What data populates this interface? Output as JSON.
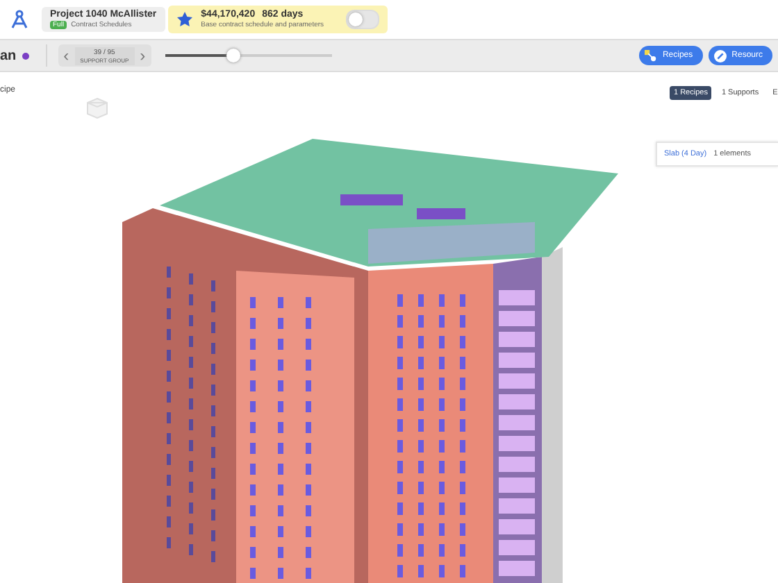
{
  "header": {
    "project": {
      "title": "Project 1040 McAllister",
      "badge": "Full",
      "subtitle": "Contract Schedules"
    },
    "contract": {
      "cost": "$44,170,420",
      "duration": "862 days",
      "description": "Base contract schedule and parameters",
      "on": false
    }
  },
  "toolbar": {
    "title": "an",
    "nav": {
      "prev": "‹",
      "position": "39 / 95",
      "group": "SUPPORT GROUP",
      "next": "›"
    },
    "slider": {
      "level": 0.41
    },
    "buttons": [
      {
        "label": "Recipes",
        "kind": "recipes"
      },
      {
        "label": "Resourc",
        "kind": "resources"
      }
    ]
  },
  "left_panel": {
    "label": "cipe"
  },
  "right_panel": {
    "tabs": [
      {
        "label": "1 Recipes",
        "selected": true
      },
      {
        "label": "1 Supports",
        "selected": false
      },
      {
        "label": "E",
        "selected": false
      }
    ],
    "card": {
      "title": "Slab (4 Day)",
      "count": "1 elements"
    }
  }
}
